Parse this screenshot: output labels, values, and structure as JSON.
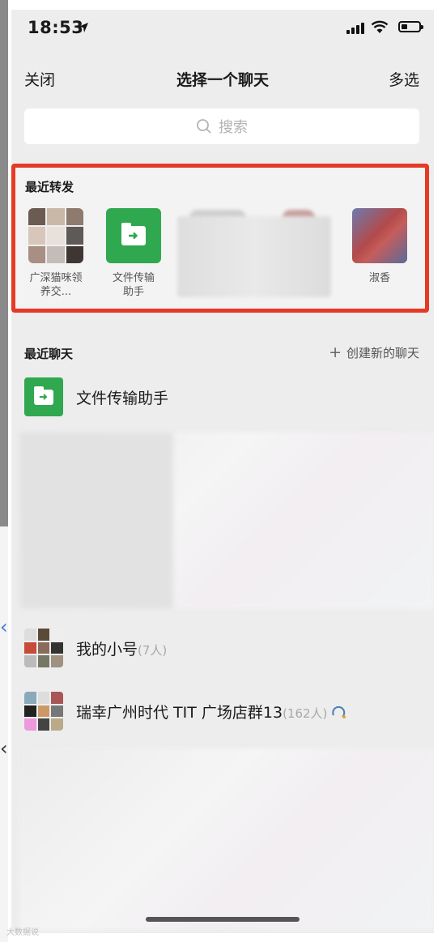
{
  "status": {
    "time": "18:53"
  },
  "nav": {
    "close": "关闭",
    "title": "选择一个聊天",
    "multi": "多选"
  },
  "search": {
    "placeholder": "搜索"
  },
  "recent_forward": {
    "title": "最近转发",
    "items": [
      {
        "name": "广深猫咪领养交..."
      },
      {
        "name": "文件传输助手"
      },
      {
        "name": "淑香"
      }
    ]
  },
  "recent_chats": {
    "title": "最近聊天",
    "new_chat": "创建新的聊天",
    "items": [
      {
        "name": "文件传输助手",
        "count": ""
      },
      {
        "name": "我的小号",
        "count": "(7人)"
      },
      {
        "name": "瑞幸广州时代 TIT 广场店群13",
        "count": "(162人)"
      }
    ]
  },
  "watermark": "大数据说",
  "colors": {
    "highlight": "#e53a25",
    "file_green": "#2fa84f"
  }
}
